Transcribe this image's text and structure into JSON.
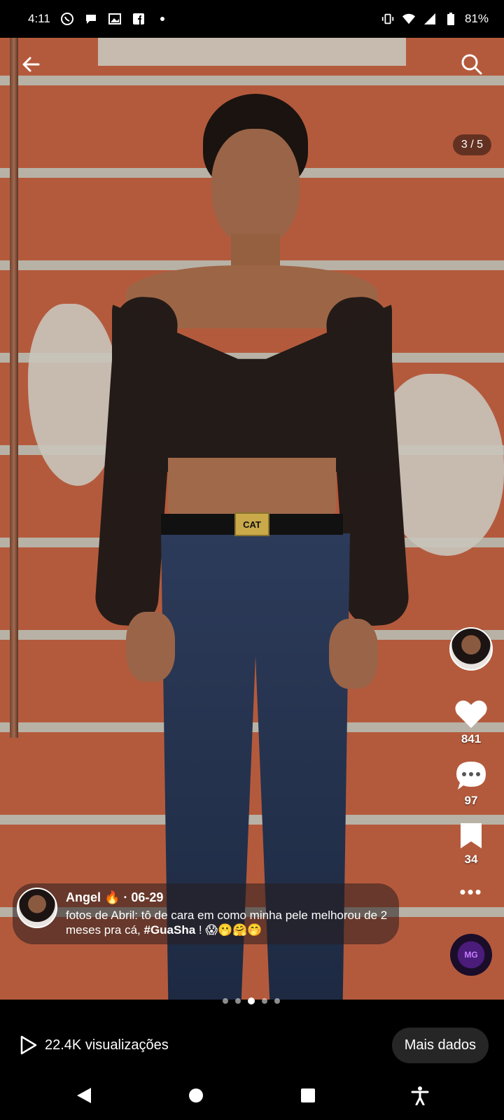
{
  "status_bar": {
    "time": "4:11",
    "battery": "81%",
    "left_icons": [
      "whatsapp-icon",
      "chat-icon",
      "gallery-icon",
      "facebook-icon",
      "dot-icon"
    ],
    "right_icons": [
      "vibrate-icon",
      "wifi-icon",
      "signal-icon",
      "battery-icon"
    ]
  },
  "header": {
    "page_counter": "3 / 5"
  },
  "post": {
    "author": "Angel 🔥",
    "date": "06-29",
    "author_line": "Angel 🔥 · 06-29",
    "caption_main": "fotos de Abril: tô de cara em como minha pele melhorou de 2 meses pra cá, ",
    "caption_hashtag": "#GuaSha",
    "caption_tail": " ! 😱🫢🤗🤭"
  },
  "buckle_text": "CAT",
  "actions": {
    "likes": "841",
    "comments": "97",
    "bookmarks": "34",
    "music_label": "MG"
  },
  "carousel": {
    "count": 5,
    "active_index": 2
  },
  "footer": {
    "views": "22.4K visualizações",
    "more_data_label": "Mais dados"
  },
  "colors": {
    "accent": "#ffffff",
    "background": "#000000",
    "button_bg": "#262626"
  }
}
